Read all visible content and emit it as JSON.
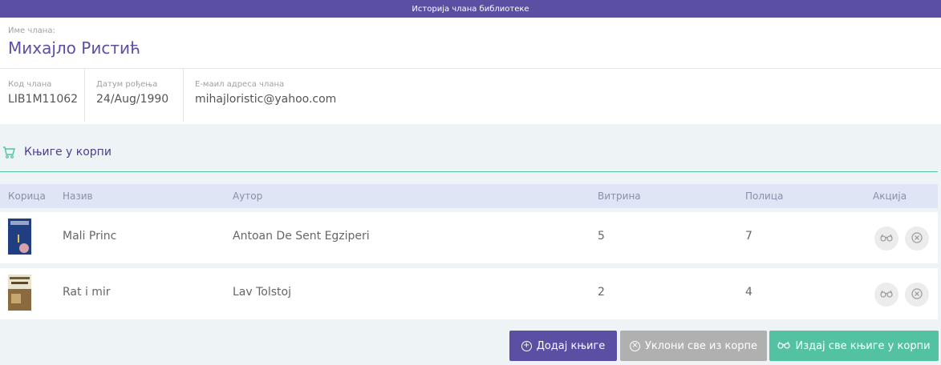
{
  "topbar": {
    "title": "Историја члана библиотеке"
  },
  "member": {
    "name_label": "Име члана:",
    "name": "Михајло Ристић",
    "code_label": "Код члана",
    "code": "LIB1M11062",
    "dob_label": "Датум рођења",
    "dob": "24/Aug/1990",
    "email_label": "E-маил адреса члана",
    "email": "mihajloristic@yahoo.com"
  },
  "cart": {
    "title": "Књиге у корпи"
  },
  "table": {
    "headers": {
      "cover": "Корица",
      "title": "Назив",
      "author": "Аутор",
      "showcase": "Витрина",
      "shelf": "Полица",
      "action": "Акција"
    },
    "rows": [
      {
        "title": "Mali Princ",
        "author": "Antoan De Sent Egziperi",
        "showcase": "5",
        "shelf": "7"
      },
      {
        "title": "Rat i mir",
        "author": "Lav Tolstoj",
        "showcase": "2",
        "shelf": "4"
      }
    ]
  },
  "buttons": {
    "add": "Додај књиге",
    "remove_all": "Уклони све из корпе",
    "issue_all": "Издај све књиге у корпи"
  },
  "colors": {
    "primary": "#5b4fa3",
    "accent": "#52c2a3",
    "muted": "#b0b0b0"
  }
}
